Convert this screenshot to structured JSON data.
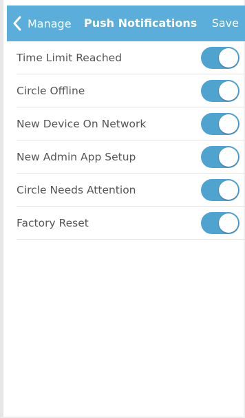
{
  "header": {
    "back_label": "Manage",
    "title": "Push Notifications",
    "save_label": "Save",
    "back_icon": "chevron-left-icon"
  },
  "colors": {
    "header_background": "#5aaed9",
    "toggle_on": "#4fa3cf",
    "label_text": "#555555"
  },
  "notifications": [
    {
      "label": "Time Limit Reached",
      "enabled": true
    },
    {
      "label": "Circle Offline",
      "enabled": true
    },
    {
      "label": "New Device On Network",
      "enabled": true
    },
    {
      "label": "New Admin App Setup",
      "enabled": true
    },
    {
      "label": "Circle Needs Attention",
      "enabled": true
    },
    {
      "label": "Factory Reset",
      "enabled": true
    }
  ]
}
